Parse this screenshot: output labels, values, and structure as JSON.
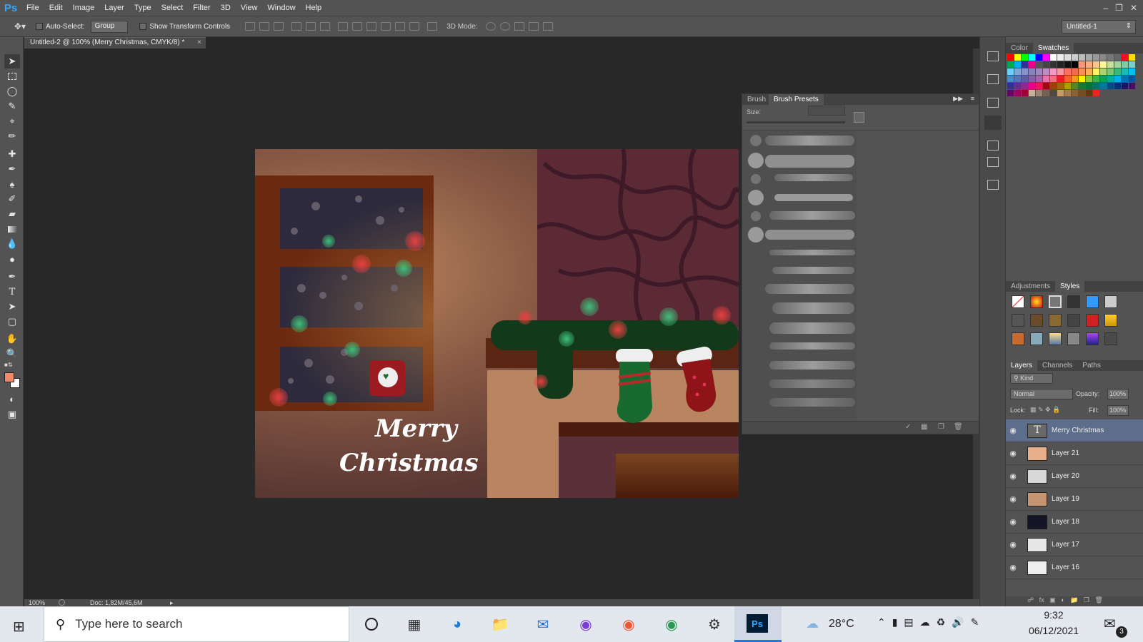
{
  "app": {
    "logo": "Ps"
  },
  "menu": [
    "File",
    "Edit",
    "Image",
    "Layer",
    "Type",
    "Select",
    "Filter",
    "3D",
    "View",
    "Window",
    "Help"
  ],
  "options": {
    "auto_select_label": "Auto-Select:",
    "auto_select_value": "Group",
    "show_transform_label": "Show Transform Controls",
    "mode_3d_label": "3D Mode:",
    "workspace": "Untitled-1"
  },
  "document": {
    "tab_title": "Untitled-2 @ 100% (Merry  Christmas, CMYK/8) *",
    "close": "×",
    "artwork_text_line1": "Merry",
    "artwork_text_line2": "Christmas"
  },
  "status": {
    "zoom": "100%",
    "doc": "Doc: 1,82M/45,6M"
  },
  "panels": {
    "color_tab": "Color",
    "swatches_tab": "Swatches",
    "adjustments_tab": "Adjustments",
    "styles_tab": "Styles",
    "layers_tab": "Layers",
    "channels_tab": "Channels",
    "paths_tab": "Paths",
    "kind": "Kind",
    "blend_mode": "Normal",
    "opacity_label": "Opacity:",
    "opacity_value": "100%",
    "lock_label": "Lock:",
    "fill_label": "Fill:",
    "fill_value": "100%"
  },
  "brush_panel": {
    "brush_tab": "Brush",
    "presets_tab": "Brush Presets",
    "size_label": "Size:"
  },
  "layers": [
    {
      "name": "Merry  Christmas",
      "type": "text",
      "selected": true
    },
    {
      "name": "Layer 21",
      "thumb": "#e8b08a"
    },
    {
      "name": "Layer 20",
      "thumb": "#d8d8d8"
    },
    {
      "name": "Layer 19",
      "thumb": "#c69470"
    },
    {
      "name": "Layer 18",
      "thumb": "#151528"
    },
    {
      "name": "Layer 17",
      "thumb": "#e6e6e6"
    },
    {
      "name": "Layer 16",
      "thumb": "#eeeeee"
    }
  ],
  "taskbar": {
    "search_placeholder": "Type here to search",
    "weather": "28°C",
    "time": "9:32",
    "date": "06/12/2021",
    "notifications": "3"
  },
  "colors": {
    "foreground": "#f0886a",
    "background": "#ffffff",
    "accent": "#31a8ff"
  }
}
